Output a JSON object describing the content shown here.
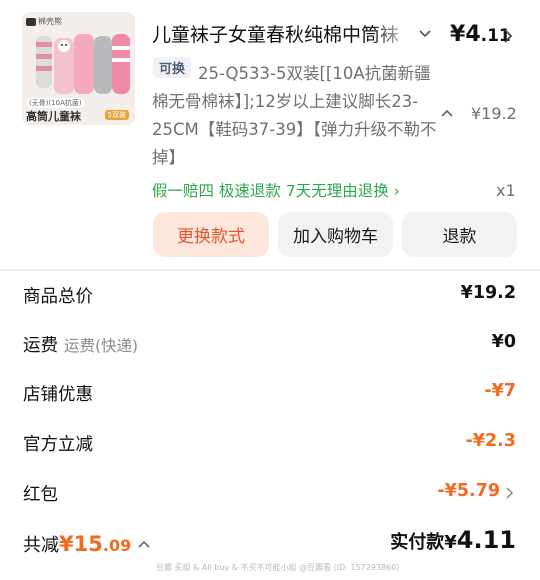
{
  "product": {
    "thumbnail": {
      "brand": "棉壳熊",
      "tag": "(无骨)(10A抗菌)",
      "caption": "高筒儿童袜",
      "badge": "5双装"
    },
    "title": "儿童袜子女童春秋纯棉中筒袜",
    "price_currency": "¥",
    "price_int": "4",
    "price_dec": ".11",
    "swap_tag": "可换",
    "spec": "25-Q533-5双装[[10A抗菌新疆棉无骨棉袜】];12岁以上建议脚长23-25CM【鞋码37-39】【弹力升级不勒不掉】",
    "original_price": "¥19.2",
    "promo": "假一赔四  极速退款  7天无理由退换 ›",
    "quantity": "x1"
  },
  "actions": {
    "change_style": "更换款式",
    "add_to_cart": "加入购物车",
    "refund": "退款"
  },
  "summary": {
    "goods_total_label": "商品总价",
    "goods_total_value": "¥19.2",
    "shipping_label": "运费",
    "shipping_sub": "运费(快递)",
    "shipping_value": "¥0",
    "shop_discount_label": "店铺优惠",
    "shop_discount_value": "-¥7",
    "official_discount_label": "官方立减",
    "official_discount_value": "-¥2.3",
    "red_packet_label": "红包",
    "red_packet_value": "-¥5.79"
  },
  "footer": {
    "total_reduce_label": "共减",
    "total_reduce_currency": "¥",
    "total_reduce_int": "15",
    "total_reduce_dec": ".09",
    "paid_label": "实付款",
    "paid_currency": "¥",
    "paid_value": "4.11",
    "watermark": "豆瓣  买组 & All buy & 不买不可能小组 @豆瓣看 (ID: 157293860)"
  },
  "colors": {
    "accent_orange": "#f26a1f",
    "promo_green": "#2fa84f",
    "primary_button_bg": "#fde6dc"
  },
  "icons": [
    "chevron-down-icon",
    "chevron-right-icon",
    "chevron-up-icon"
  ]
}
